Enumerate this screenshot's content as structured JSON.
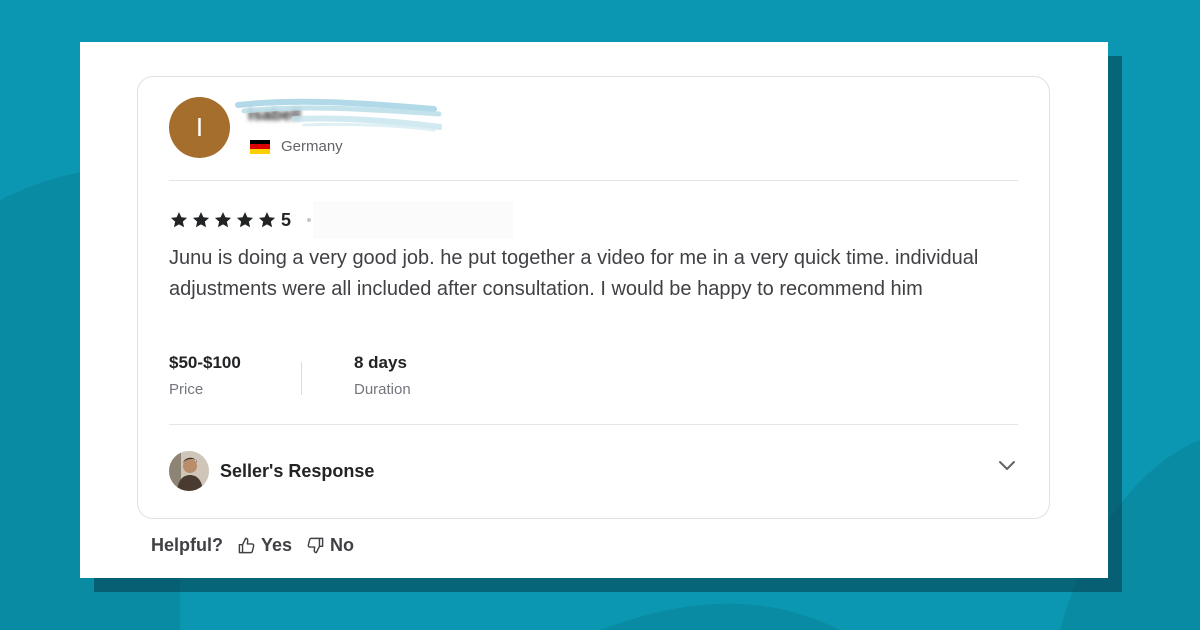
{
  "reviewer": {
    "avatar_initial": "I",
    "name": "Isabell",
    "country": "Germany",
    "avatar_color": "#a56e2c"
  },
  "rating": {
    "stars": 5,
    "value": "5"
  },
  "review": {
    "text": "Junu is doing a very good job. he put together a video for me in a very quick time. individual adjustments were all included after consultation. I would be happy to recommend him"
  },
  "details": {
    "price_value": "$50-$100",
    "price_label": "Price",
    "duration_value": "8 days",
    "duration_label": "Duration"
  },
  "seller_response": {
    "label": "Seller's Response",
    "expand_icon": "chevron-down-icon"
  },
  "helpful": {
    "label": "Helpful?",
    "yes_label": "Yes",
    "no_label": "No",
    "yes_icon": "thumbs-up-icon",
    "no_icon": "thumbs-down-icon"
  },
  "colors": {
    "background": "#0b97b1",
    "star": "#222325",
    "text": "#404145"
  }
}
